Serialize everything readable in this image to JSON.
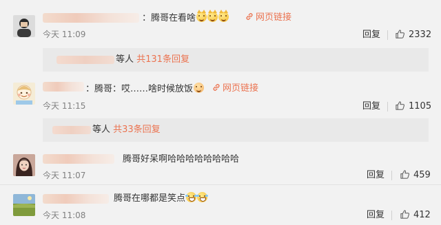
{
  "comments": [
    {
      "text": "：腾哥在看啥",
      "emoji_count": 3,
      "emoji_icon": "cat-face-icon",
      "link_label": "网页链接",
      "time": "今天 11:09",
      "reply_label": "回复",
      "likes": "2332",
      "sub_replies": {
        "prefix": "等人 ",
        "count_text": "共131条回复"
      }
    },
    {
      "text": "：腾哥：哎……啥时候放饭",
      "emoji_icon": "smiling-face-icon",
      "link_label": "网页链接",
      "time": "今天 11:15",
      "reply_label": "回复",
      "likes": "1105",
      "sub_replies": {
        "prefix": "等人 ",
        "count_text": "共33条回复"
      }
    },
    {
      "text": "腾哥好呆啊哈哈哈哈哈哈哈哈",
      "time": "今天 11:07",
      "reply_label": "回复",
      "likes": "459"
    },
    {
      "text": "腾哥在哪都是笑点",
      "emoji_icon": "laughing-tears-icon",
      "emoji_count": 2,
      "time": "今天 11:08",
      "reply_label": "回复",
      "likes": "412"
    }
  ]
}
